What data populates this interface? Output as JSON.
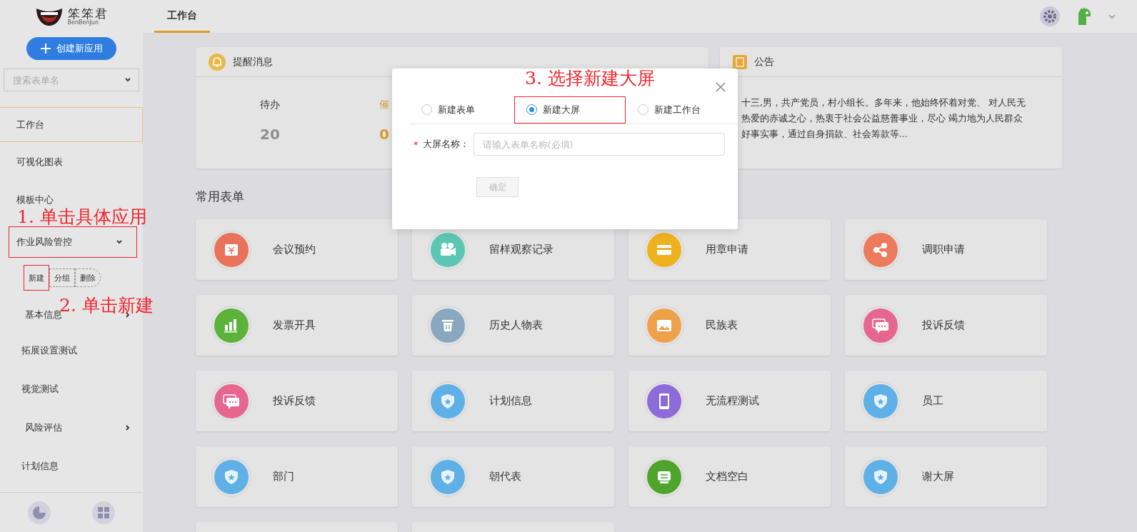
{
  "logo": {
    "name": "笨笨君",
    "subtitle": "BenBenJun"
  },
  "top_tabs": [
    {
      "label": "工作台",
      "selected": true
    }
  ],
  "sidebar": {
    "create_button": "创建新应用",
    "search": {
      "placeholder": "搜索表单名"
    },
    "items": [
      {
        "label": "工作台",
        "kind": "link",
        "selected": true,
        "marked": false
      },
      {
        "label": "可视化图表",
        "kind": "link",
        "selected": false,
        "marked": false
      },
      {
        "label": "模板中心",
        "kind": "link",
        "selected": false,
        "marked": false
      },
      {
        "label": "作业风险管控",
        "kind": "group",
        "selected": false,
        "expanded": true,
        "marked": true,
        "actions": [
          {
            "label": "新建",
            "marked": true
          },
          {
            "label": "分组",
            "marked": false
          },
          {
            "label": "删除",
            "marked": false
          }
        ],
        "children": [
          {
            "label": "基本信息",
            "kind": "group",
            "expanded": false
          },
          {
            "label": "拓展设置测试",
            "kind": "link"
          },
          {
            "label": "视觉测试",
            "kind": "link"
          },
          {
            "label": "风险评估",
            "kind": "group",
            "expanded": false
          },
          {
            "label": "计划信息",
            "kind": "link"
          }
        ]
      }
    ]
  },
  "annotations": [
    {
      "text": "1. 单击具体应用"
    },
    {
      "text": "2. 单击新建"
    },
    {
      "text": "3. 选择新建大屏"
    }
  ],
  "notice": {
    "title": "提醒消息",
    "stats": [
      {
        "label": "待办",
        "value": "20",
        "color": "#8e8e94"
      },
      {
        "label": "催",
        "value": "0",
        "color": "#d99a2b"
      }
    ]
  },
  "announcement": {
    "title": "公告",
    "lines": [
      "十三,男，共产党员，村小组长。多年来，他始终怀着对党、 对人民无",
      "热爱的赤诚之心，热衷于社会公益慈善事业，尽心 竭力地为人民群众",
      "好事实事，通过自身捐款、社会筹款等..."
    ]
  },
  "section_title": "常用表单",
  "tiles": [
    {
      "label": "会议预约",
      "kind": "yen",
      "color": "#e8735a"
    },
    {
      "label": "留样观察记录",
      "kind": "camera",
      "color": "#5cc6b4"
    },
    {
      "label": "用章申请",
      "kind": "card",
      "color": "#efb21f"
    },
    {
      "label": "调职申请",
      "kind": "share",
      "color": "#ec7a5c"
    },
    {
      "label": "发票开具",
      "kind": "bars",
      "color": "#5bb339"
    },
    {
      "label": "历史人物表",
      "kind": "trash",
      "color": "#8aa7c0"
    },
    {
      "label": "民族表",
      "kind": "picture",
      "color": "#efa14a"
    },
    {
      "label": "投诉反馈",
      "kind": "chat",
      "color": "#e76690"
    },
    {
      "label": "投诉反馈",
      "kind": "chat",
      "color": "#e76690"
    },
    {
      "label": "计划信息",
      "kind": "shield",
      "color": "#5fb0e6"
    },
    {
      "label": "无流程测试",
      "kind": "phone",
      "color": "#8d6bd8"
    },
    {
      "label": "员工",
      "kind": "shield",
      "color": "#5fb0e6"
    },
    {
      "label": "部门",
      "kind": "shield",
      "color": "#5fb0e6"
    },
    {
      "label": "朝代表",
      "kind": "shield",
      "color": "#5fb0e6"
    },
    {
      "label": "文档空白",
      "kind": "doc",
      "color": "#4fa52c"
    },
    {
      "label": "谢大屏",
      "kind": "shield",
      "color": "#5fb0e6"
    },
    {
      "kind": "cut"
    },
    {
      "kind": "cut"
    }
  ],
  "modal": {
    "options": [
      {
        "label": "新建表单",
        "selected": false,
        "marked": false
      },
      {
        "label": "新建大屏",
        "selected": true,
        "marked": true
      },
      {
        "label": "新建工作台",
        "selected": false,
        "marked": false
      }
    ],
    "field": {
      "required_mark": "*",
      "label": "大屏名称：",
      "placeholder": "请输入表单名称(必填)"
    },
    "submit": {
      "label": "确定",
      "disabled": true
    }
  }
}
